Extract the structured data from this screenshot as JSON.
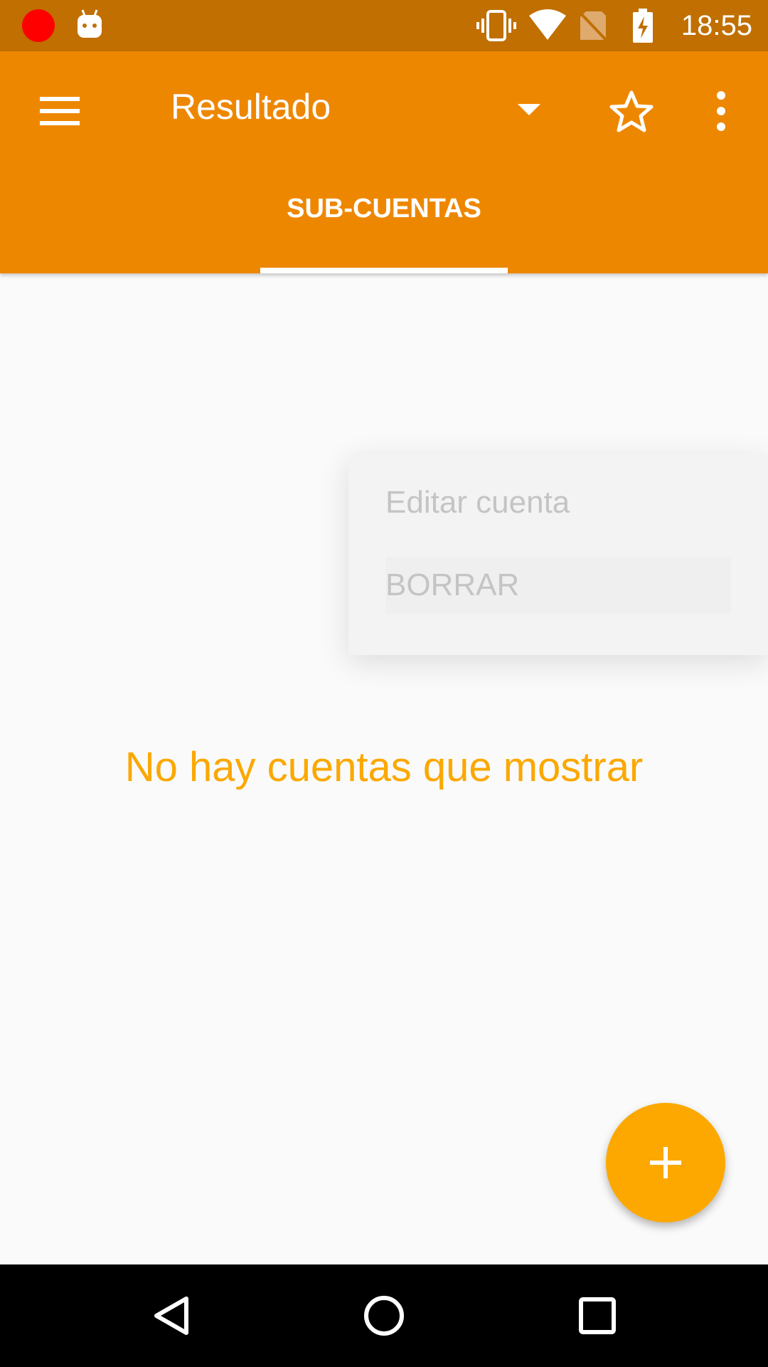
{
  "status_bar": {
    "time": "18:55",
    "icons": [
      "record-dot",
      "android-debug-icon",
      "vibrate-icon",
      "wifi-icon",
      "no-sim-icon",
      "battery-charging-icon"
    ],
    "record_color": "#ff0000"
  },
  "toolbar": {
    "title": "Resultado",
    "icons": [
      "menu-icon",
      "dropdown-arrow-icon",
      "star-outline-icon",
      "more-vert-icon"
    ],
    "background": "#ee8700"
  },
  "tabs": [
    {
      "label": "SUB-CUENTAS",
      "selected": true
    }
  ],
  "popup_menu": {
    "items": [
      {
        "label": "Editar cuenta"
      },
      {
        "label": "BORRAR"
      }
    ]
  },
  "content": {
    "empty_message": "No hay cuentas que mostrar",
    "accent_color": "#fba800"
  },
  "fab": {
    "icon": "add-icon"
  },
  "nav_bar": {
    "icons": [
      "back-icon",
      "home-icon",
      "recents-icon"
    ]
  }
}
